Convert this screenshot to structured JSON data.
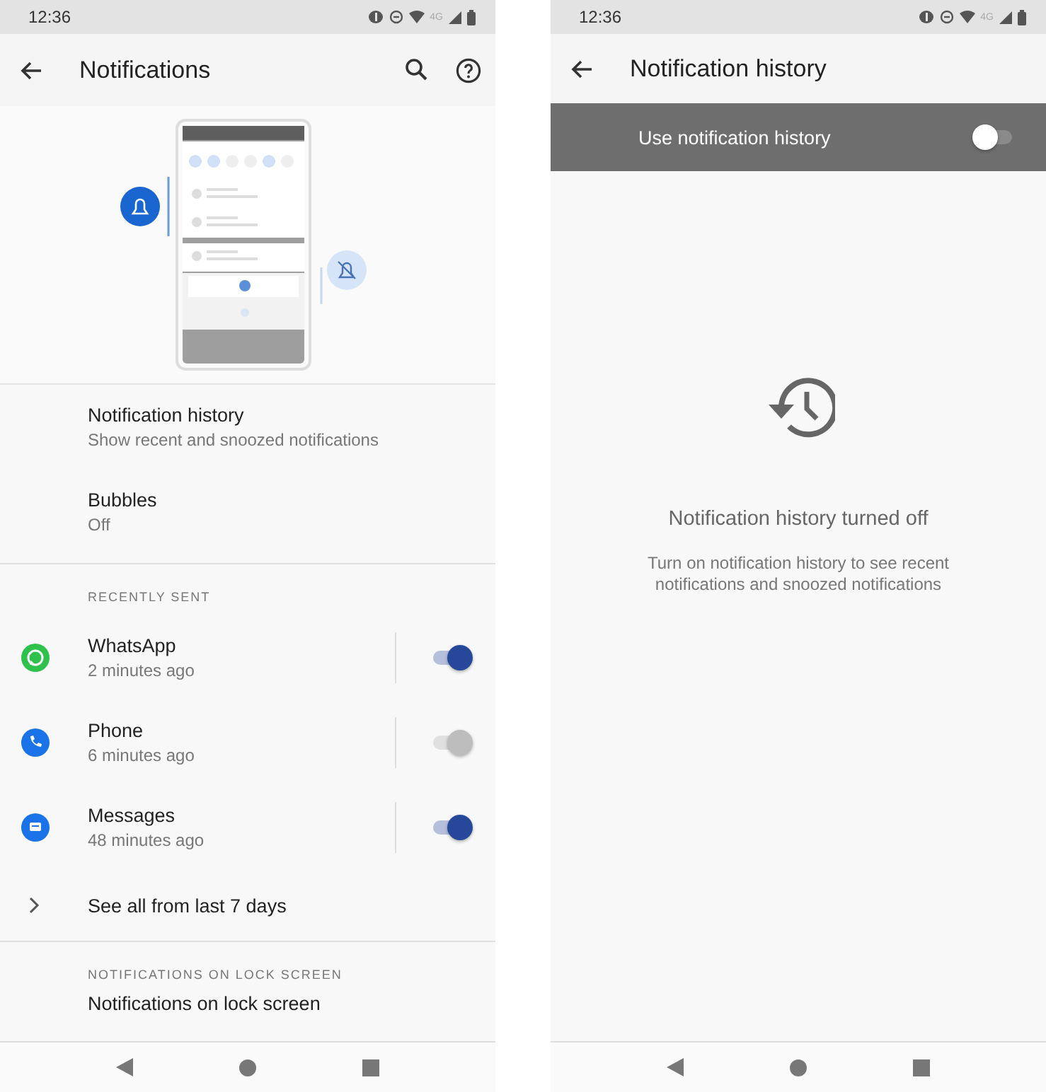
{
  "notifications_screen": {
    "status_bar": {
      "time": "12:36",
      "network": "4G"
    },
    "app_bar": {
      "title": "Notifications"
    },
    "settings": [
      {
        "title": "Notification history",
        "subtitle": "Show recent and snoozed notifications"
      },
      {
        "title": "Bubbles",
        "subtitle": "Off"
      }
    ],
    "recently_sent": {
      "header": "RECENTLY SENT",
      "apps": [
        {
          "kind": "whatsapp",
          "name": "WhatsApp",
          "time": "2 minutes ago",
          "on": true,
          "disabled": false,
          "color": "#2ec14b"
        },
        {
          "kind": "phone",
          "name": "Phone",
          "time": "6 minutes ago",
          "on": true,
          "disabled": true,
          "color": "#1a73e8"
        },
        {
          "kind": "messages",
          "name": "Messages",
          "time": "48 minutes ago",
          "on": true,
          "disabled": false,
          "color": "#1a73e8"
        }
      ],
      "see_all": "See all from last 7 days"
    },
    "lock_screen": {
      "header": "NOTIFICATIONS ON LOCK SCREEN",
      "title": "Notifications on lock screen"
    }
  },
  "history_screen": {
    "status_bar": {
      "time": "12:36",
      "network": "4G"
    },
    "app_bar": {
      "title": "Notification history"
    },
    "master_switch": {
      "label": "Use notification history",
      "on": false
    },
    "empty_state": {
      "title": "Notification history turned off",
      "description": "Turn on notification history to see recent notifications and snoozed notifications"
    }
  }
}
